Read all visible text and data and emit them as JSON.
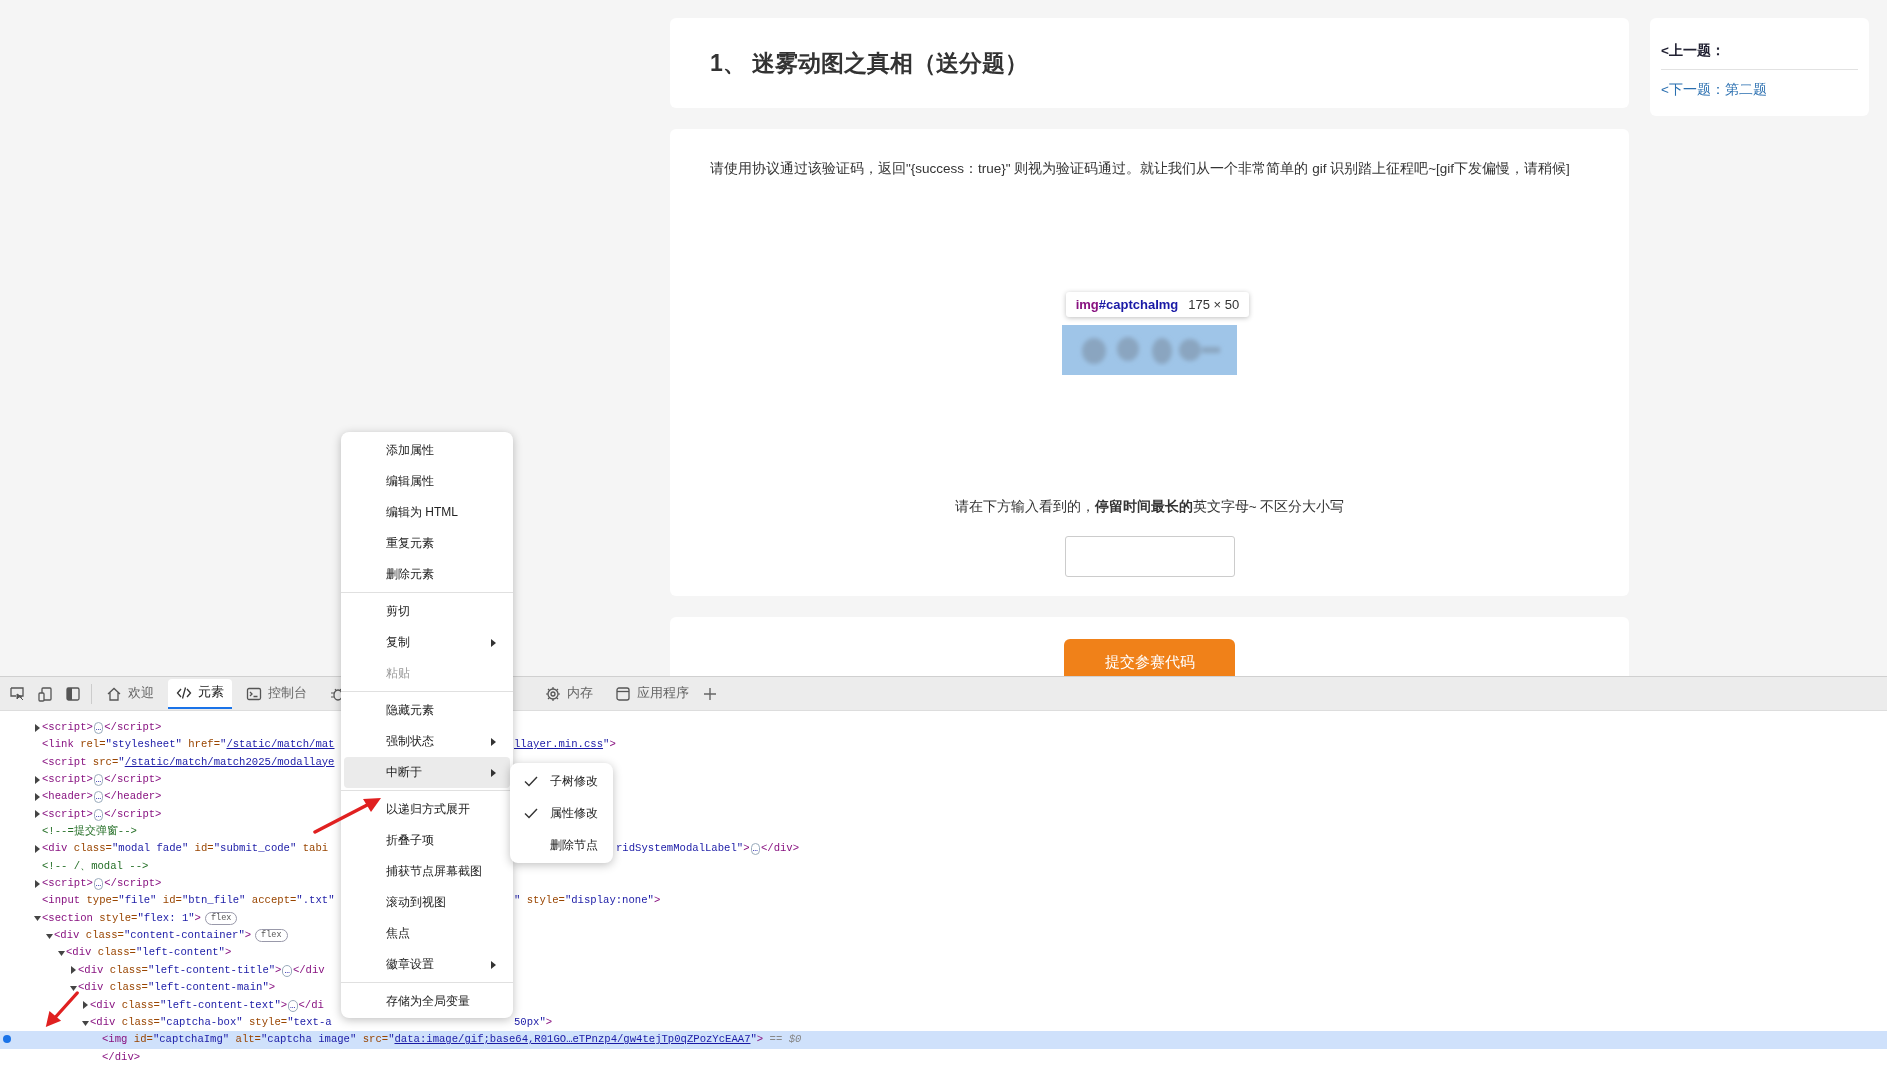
{
  "page": {
    "title": "1、 迷雾动图之真相（送分题）",
    "description": "请使用协议通过该验证码，返回\"{success：true}\" 则视为验证码通过。就让我们从一个非常简单的 gif 识别踏上征程吧~[gif下发偏慢，请稍候]",
    "tooltip": {
      "tag": "img",
      "id": "#captchaImg",
      "size": "175 × 50"
    },
    "instruction": "请在下方输入看到的，**停留时间最长的**英文字母~ 不区分大小写",
    "submit_button": "提交参赛代码",
    "nav": [
      {
        "label": "<上一题：",
        "disabled": true
      },
      {
        "label": "<下一题：第二题",
        "disabled": false
      }
    ]
  },
  "devtools": {
    "tabs": [
      {
        "label": "欢迎",
        "selected": false
      },
      {
        "label": "元素",
        "selected": true
      },
      {
        "label": "控制台",
        "selected": false
      },
      {
        "label": "内存",
        "selected": false
      },
      {
        "label": "应用程序",
        "selected": false
      }
    ],
    "dom_tree": [
      {
        "expanded": false,
        "selected": false,
        "left": [
          {
            "kind": "tag",
            "text": "<script>"
          },
          {
            "kind": "more",
            "text": "…"
          },
          {
            "kind": "tag",
            "text": "</script>"
          }
        ]
      },
      {
        "selected": false,
        "left": [
          {
            "kind": "tag",
            "text": "<link"
          },
          {
            "kind": "attr",
            "text": " rel="
          },
          {
            "kind": "value",
            "text": "\"stylesheet\""
          },
          {
            "kind": "attr",
            "text": " href="
          },
          {
            "kind": "value",
            "text": "\""
          },
          {
            "kind": "link",
            "text": "/static/match/mat"
          }
        ],
        "right": [
          {
            "kind": "link",
            "text": "llayer.min.css"
          },
          {
            "kind": "value",
            "text": "\""
          },
          {
            "kind": "tag",
            "text": ">"
          }
        ]
      },
      {
        "selected": false,
        "left": [
          {
            "kind": "tag",
            "text": "<script"
          },
          {
            "kind": "attr",
            "text": " src="
          },
          {
            "kind": "value",
            "text": "\""
          },
          {
            "kind": "link",
            "text": "/static/match/match2025/modallaye"
          }
        ]
      },
      {
        "expanded": false,
        "selected": false,
        "left": [
          {
            "kind": "tag",
            "text": "<script>"
          },
          {
            "kind": "more",
            "text": "…"
          },
          {
            "kind": "tag",
            "text": "</script>"
          }
        ]
      },
      {
        "expanded": false,
        "selected": false,
        "left": [
          {
            "kind": "tag",
            "text": "<header>"
          },
          {
            "kind": "more",
            "text": "…"
          },
          {
            "kind": "tag",
            "text": "</header>"
          }
        ]
      },
      {
        "expanded": false,
        "selected": false,
        "left": [
          {
            "kind": "tag",
            "text": "<script>"
          },
          {
            "kind": "more",
            "text": "…"
          },
          {
            "kind": "tag",
            "text": "</script>"
          }
        ]
      },
      {
        "selected": false,
        "left": [
          {
            "kind": "comment",
            "text": "<!--=提交弹窗-->"
          }
        ]
      },
      {
        "expanded": false,
        "selected": false,
        "left": [
          {
            "kind": "tag",
            "text": "<div"
          },
          {
            "kind": "attr",
            "text": " class="
          },
          {
            "kind": "value",
            "text": "\"modal fade\""
          },
          {
            "kind": "attr",
            "text": " id="
          },
          {
            "kind": "value",
            "text": "\"submit_code\""
          },
          {
            "kind": "attr",
            "text": " tabi"
          }
        ],
        "right": [
          {
            "kind": "value",
            "text": "ridSystemModalLabel\""
          },
          {
            "kind": "tag",
            "text": ">"
          },
          {
            "kind": "more",
            "text": "…"
          },
          {
            "kind": "tag",
            "text": "</div>"
          }
        ]
      },
      {
        "selected": false,
        "left": [
          {
            "kind": "comment",
            "text": "<!-- /、modal -->"
          }
        ]
      },
      {
        "expanded": false,
        "selected": false,
        "left": [
          {
            "kind": "tag",
            "text": "<script>"
          },
          {
            "kind": "more",
            "text": "…"
          },
          {
            "kind": "tag",
            "text": "</script>"
          }
        ]
      },
      {
        "selected": false,
        "left": [
          {
            "kind": "tag",
            "text": "<input"
          },
          {
            "kind": "attr",
            "text": " type="
          },
          {
            "kind": "value",
            "text": "\"file\""
          },
          {
            "kind": "attr",
            "text": " id="
          },
          {
            "kind": "value",
            "text": "\"btn_file\""
          },
          {
            "kind": "attr",
            "text": " accept="
          },
          {
            "kind": "value",
            "text": "\".txt\""
          }
        ],
        "right": [
          {
            "kind": "value",
            "text": "\""
          },
          {
            "kind": "attr",
            "text": " style="
          },
          {
            "kind": "value",
            "text": "\"display:none\""
          },
          {
            "kind": "tag",
            "text": ">"
          }
        ]
      },
      {
        "expanded": true,
        "selected": false,
        "badge": "flex",
        "left": [
          {
            "kind": "tag",
            "text": "<section"
          },
          {
            "kind": "attr",
            "text": " style="
          },
          {
            "kind": "value",
            "text": "\"flex: 1\""
          },
          {
            "kind": "tag",
            "text": ">"
          }
        ],
        "children": [
          {
            "expanded": true,
            "selected": false,
            "badge": "flex",
            "left": [
              {
                "kind": "tag",
                "text": "<div"
              },
              {
                "kind": "attr",
                "text": " class="
              },
              {
                "kind": "value",
                "text": "\"content-container\""
              },
              {
                "kind": "tag",
                "text": ">"
              }
            ],
            "children": [
              {
                "expanded": true,
                "selected": false,
                "left": [
                  {
                    "kind": "tag",
                    "text": "<div"
                  },
                  {
                    "kind": "attr",
                    "text": " class="
                  },
                  {
                    "kind": "value",
                    "text": "\"left-content\""
                  },
                  {
                    "kind": "tag",
                    "text": ">"
                  }
                ],
                "children": [
                  {
                    "expanded": false,
                    "selected": false,
                    "left": [
                      {
                        "kind": "tag",
                        "text": "<div"
                      },
                      {
                        "kind": "attr",
                        "text": " class="
                      },
                      {
                        "kind": "value",
                        "text": "\"left-content-title\""
                      },
                      {
                        "kind": "tag",
                        "text": ">"
                      },
                      {
                        "kind": "more",
                        "text": "…"
                      },
                      {
                        "kind": "tag",
                        "text": "</div"
                      }
                    ]
                  },
                  {
                    "expanded": true,
                    "selected": false,
                    "left": [
                      {
                        "kind": "tag",
                        "text": "<div"
                      },
                      {
                        "kind": "attr",
                        "text": " class="
                      },
                      {
                        "kind": "value",
                        "text": "\"left-content-main\""
                      },
                      {
                        "kind": "tag",
                        "text": ">"
                      }
                    ],
                    "children": [
                      {
                        "expanded": false,
                        "selected": false,
                        "left": [
                          {
                            "kind": "tag",
                            "text": "<div"
                          },
                          {
                            "kind": "attr",
                            "text": " class="
                          },
                          {
                            "kind": "value",
                            "text": "\"left-content-text\""
                          },
                          {
                            "kind": "tag",
                            "text": ">"
                          },
                          {
                            "kind": "more",
                            "text": "…"
                          },
                          {
                            "kind": "tag",
                            "text": "</di"
                          }
                        ]
                      },
                      {
                        "expanded": true,
                        "selected": false,
                        "left": [
                          {
                            "kind": "tag",
                            "text": "<div"
                          },
                          {
                            "kind": "attr",
                            "text": " class="
                          },
                          {
                            "kind": "value",
                            "text": "\"captcha-box\""
                          },
                          {
                            "kind": "attr",
                            "text": " style="
                          },
                          {
                            "kind": "value",
                            "text": "\"text-a"
                          }
                        ],
                        "right": [
                          {
                            "kind": "value",
                            "text": "50px\""
                          },
                          {
                            "kind": "tag",
                            "text": ">"
                          }
                        ],
                        "children": [
                          {
                            "selected": true,
                            "left": [
                              {
                                "kind": "tag",
                                "text": "<img"
                              },
                              {
                                "kind": "attr",
                                "text": " id="
                              },
                              {
                                "kind": "value",
                                "text": "\"captchaImg\""
                              },
                              {
                                "kind": "attr",
                                "text": " alt="
                              },
                              {
                                "kind": "value",
                                "text": "\"captcha image\""
                              },
                              {
                                "kind": "attr",
                                "text": " src="
                              },
                              {
                                "kind": "value",
                                "text": "\""
                              },
                              {
                                "kind": "link",
                                "text": "data:image/gif;base64,R01GO…eTPnzp4/gw4tejTp0qZPozYcEAA7"
                              },
                              {
                                "kind": "value",
                                "text": "\""
                              },
                              {
                                "kind": "tag",
                                "text": ">"
                              },
                              {
                                "kind": "hint",
                                "text": " == $0"
                              }
                            ]
                          }
                        ],
                        "close": [
                          {
                            "kind": "tag",
                            "text": "</div>"
                          }
                        ]
                      }
                    ]
                  }
                ]
              }
            ]
          }
        ]
      }
    ],
    "context_menu": [
      {
        "kind": "item",
        "label": "添加属性",
        "submenu": false,
        "disabled": false,
        "selected": false
      },
      {
        "kind": "item",
        "label": "编辑属性",
        "submenu": false,
        "disabled": false,
        "selected": false
      },
      {
        "kind": "item",
        "label": "编辑为 HTML",
        "submenu": false,
        "disabled": false,
        "selected": false
      },
      {
        "kind": "item",
        "label": "重复元素",
        "submenu": false,
        "disabled": false,
        "selected": false
      },
      {
        "kind": "item",
        "label": "删除元素",
        "submenu": false,
        "disabled": false,
        "selected": false
      },
      {
        "kind": "separator"
      },
      {
        "kind": "item",
        "label": "剪切",
        "submenu": false,
        "disabled": false,
        "selected": false
      },
      {
        "kind": "item",
        "label": "复制",
        "submenu": true,
        "disabled": false,
        "selected": false
      },
      {
        "kind": "item",
        "label": "粘贴",
        "submenu": false,
        "disabled": true,
        "selected": false
      },
      {
        "kind": "separator"
      },
      {
        "kind": "item",
        "label": "隐藏元素",
        "submenu": false,
        "disabled": false,
        "selected": false
      },
      {
        "kind": "item",
        "label": "强制状态",
        "submenu": true,
        "disabled": false,
        "selected": false
      },
      {
        "kind": "item",
        "label": "中断于",
        "submenu": true,
        "disabled": false,
        "selected": true
      },
      {
        "kind": "separator"
      },
      {
        "kind": "item",
        "label": "以递归方式展开",
        "submenu": false,
        "disabled": false,
        "selected": false
      },
      {
        "kind": "item",
        "label": "折叠子项",
        "submenu": false,
        "disabled": false,
        "selected": false
      },
      {
        "kind": "item",
        "label": "捕获节点屏幕截图",
        "submenu": false,
        "disabled": false,
        "selected": false
      },
      {
        "kind": "item",
        "label": "滚动到视图",
        "submenu": false,
        "disabled": false,
        "selected": false
      },
      {
        "kind": "item",
        "label": "焦点",
        "submenu": false,
        "disabled": false,
        "selected": false
      },
      {
        "kind": "item",
        "label": "徽章设置",
        "submenu": true,
        "disabled": false,
        "selected": false
      },
      {
        "kind": "separator"
      },
      {
        "kind": "item",
        "label": "存储为全局变量",
        "submenu": false,
        "disabled": false,
        "selected": false
      }
    ],
    "submenu": [
      {
        "label": "子树修改",
        "checked": true
      },
      {
        "label": "属性修改",
        "checked": true
      },
      {
        "label": "删除节点",
        "checked": false
      }
    ]
  }
}
